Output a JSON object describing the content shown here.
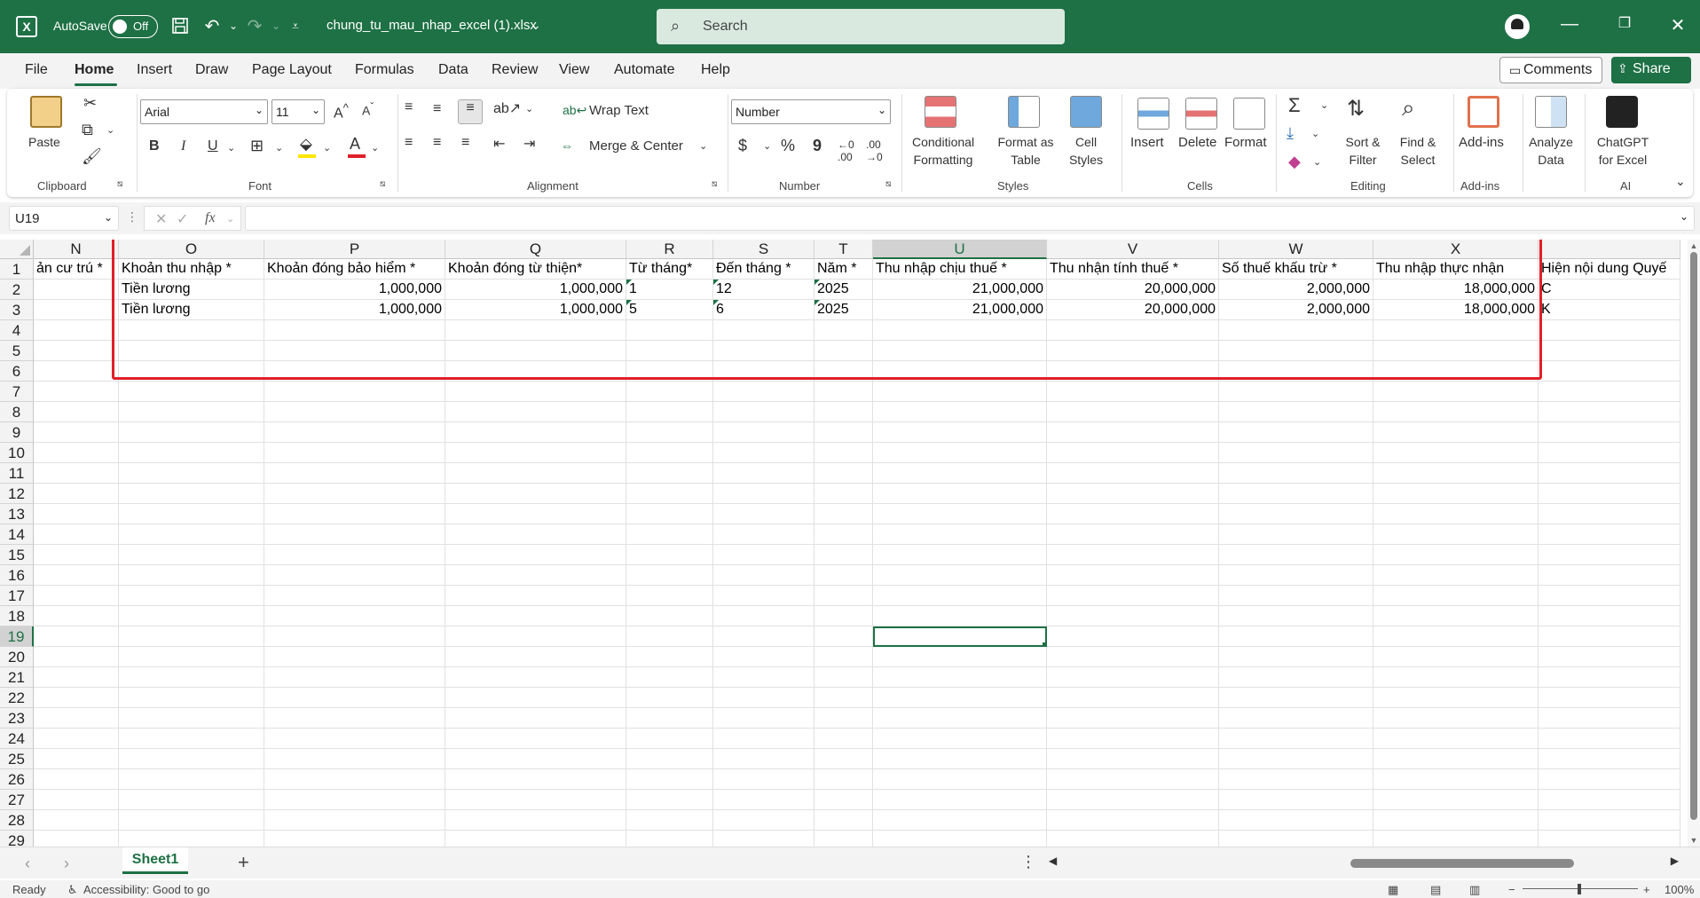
{
  "titlebar": {
    "autosave_label": "AutoSave",
    "autosave_state": "Off",
    "filename": "chung_tu_mau_nhap_excel (1).xlsx",
    "search_placeholder": "Search"
  },
  "menu": {
    "items": [
      "File",
      "Home",
      "Insert",
      "Draw",
      "Page Layout",
      "Formulas",
      "Data",
      "Review",
      "View",
      "Automate",
      "Help"
    ],
    "active": "Home",
    "comments_label": "Comments",
    "share_label": "Share"
  },
  "ribbon": {
    "clipboard": {
      "paste": "Paste",
      "label": "Clipboard"
    },
    "font": {
      "name": "Arial",
      "size": "11",
      "label": "Font",
      "bold": "B",
      "italic": "I",
      "underline": "U"
    },
    "alignment": {
      "wrap_text": "Wrap Text",
      "merge_center": "Merge & Center",
      "label": "Alignment"
    },
    "number": {
      "format": "Number",
      "label": "Number",
      "currency": "$",
      "percent": "%",
      "comma": "9"
    },
    "styles": {
      "conditional": [
        "Conditional",
        "Formatting"
      ],
      "format_table": [
        "Format as",
        "Table"
      ],
      "cell_styles": [
        "Cell",
        "Styles"
      ],
      "label": "Styles"
    },
    "cells": {
      "insert": "Insert",
      "delete": "Delete",
      "format": "Format",
      "label": "Cells"
    },
    "editing": {
      "sum": "Σ",
      "sort_filter": [
        "Sort &",
        "Filter"
      ],
      "find_select": [
        "Find &",
        "Select"
      ],
      "label": "Editing"
    },
    "addins": {
      "addins": "Add-ins",
      "label": "Add-ins"
    },
    "analyze": {
      "label": [
        "Analyze",
        "Data"
      ]
    },
    "ai": {
      "chatgpt": [
        "ChatGPT",
        "for Excel"
      ],
      "label": "AI"
    }
  },
  "formula_bar": {
    "name_box": "U19",
    "fx": "fx",
    "content": ""
  },
  "sheet": {
    "columns": [
      "N",
      "O",
      "P",
      "Q",
      "R",
      "S",
      "T",
      "U",
      "V",
      "W",
      "X",
      ""
    ],
    "selected_column": "U",
    "row_numbers": [
      "1",
      "2",
      "3",
      "4",
      "5",
      "6",
      "7",
      "8",
      "9",
      "10",
      "11",
      "12",
      "13",
      "14",
      "15",
      "16",
      "17",
      "18",
      "19",
      "20",
      "21",
      "22",
      "23",
      "24",
      "25",
      "26",
      "27",
      "28",
      "29"
    ],
    "selected_row": "19",
    "header_row": [
      "ản cư trú *",
      "Khoản thu nhập *",
      "Khoản đóng bảo hiểm *",
      "Khoản đóng từ thiện*",
      "Từ tháng*",
      "Đến tháng *",
      "Năm *",
      "Thu nhập chịu thuế *",
      "Thu nhận tính thuế *",
      "Số thuế khấu trừ *",
      "Thu nhập thực nhận",
      "Hiện nội dung Quyế"
    ],
    "rows": [
      [
        "",
        "Tiền lương",
        "1,000,000",
        "1,000,000",
        "1",
        "12",
        "2025",
        "21,000,000",
        "20,000,000",
        "2,000,000",
        "18,000,000",
        "C"
      ],
      [
        "",
        "Tiền lương",
        "1,000,000",
        "1,000,000",
        "5",
        "6",
        "2025",
        "21,000,000",
        "20,000,000",
        "2,000,000",
        "18,000,000",
        "K"
      ]
    ],
    "tab_name": "Sheet1"
  },
  "status": {
    "ready": "Ready",
    "accessibility": "Accessibility: Good to go",
    "zoom": "100%"
  },
  "colors": {
    "accent": "#1e7145",
    "highlight": "#e01f2a"
  }
}
